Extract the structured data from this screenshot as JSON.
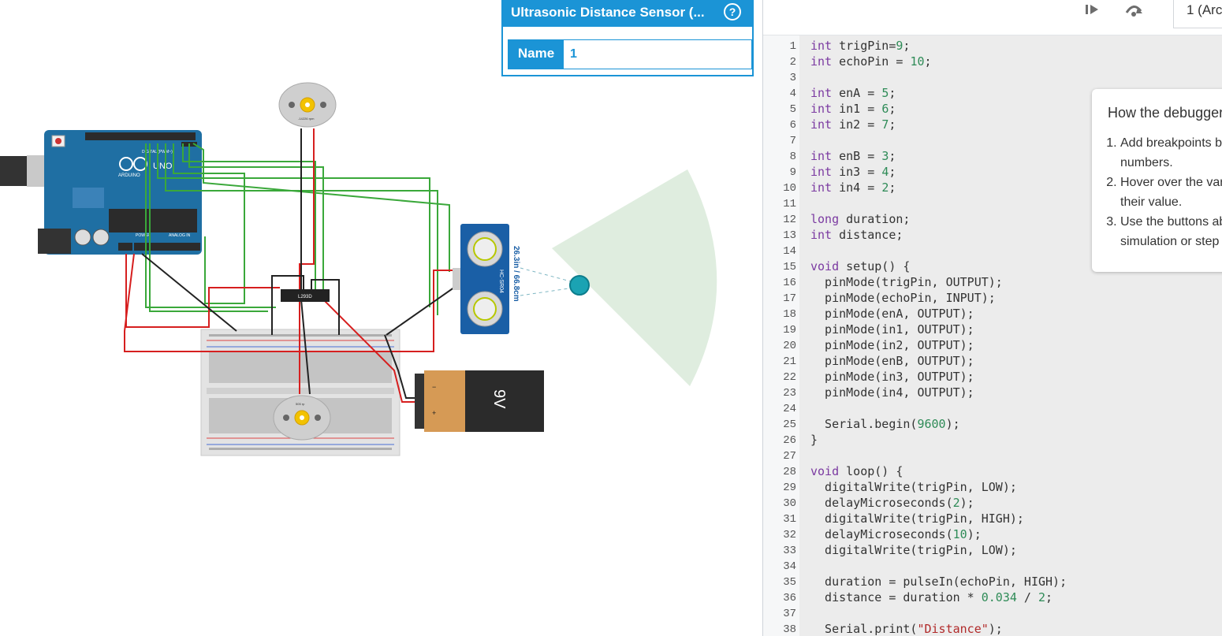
{
  "inspector": {
    "title": "Ultrasonic Distance Sensor (...",
    "help_icon": "?",
    "name_label": "Name",
    "name_value": "1"
  },
  "circuit": {
    "arduino_board_label": "UNO",
    "arduino_brand": "ARDUINO",
    "arduino_digital_label": "DIGITAL (PWM~)",
    "arduino_power_label": "POWER",
    "arduino_analog_label": "ANALOG IN",
    "driver_chip_label": "L293D",
    "sensor_label": "HC-SR04",
    "sensor_reading": "26.3in / 66.8cm",
    "battery_label": "9V",
    "motor_top_label": "-14226 rpm",
    "motor_bottom_label": "505 rp",
    "battery_minus": "−",
    "battery_plus": "+"
  },
  "toolbar": {
    "file_tab": "1 (Arc"
  },
  "code": {
    "lines": [
      "int trigPin=9;",
      "int echoPin = 10;",
      "",
      "int enA = 5;",
      "int in1 = 6;",
      "int in2 = 7;",
      "",
      "int enB = 3;",
      "int in3 = 4;",
      "int in4 = 2;",
      "",
      "long duration;",
      "int distance;",
      "",
      "void setup() {",
      "  pinMode(trigPin, OUTPUT);",
      "  pinMode(echoPin, INPUT);",
      "  pinMode(enA, OUTPUT);",
      "  pinMode(in1, OUTPUT);",
      "  pinMode(in2, OUTPUT);",
      "  pinMode(enB, OUTPUT);",
      "  pinMode(in3, OUTPUT);",
      "  pinMode(in4, OUTPUT);",
      "",
      "  Serial.begin(9600);",
      "}",
      "",
      "void loop() {",
      "  digitalWrite(trigPin, LOW);",
      "  delayMicroseconds(2);",
      "  digitalWrite(trigPin, HIGH);",
      "  delayMicroseconds(10);",
      "  digitalWrite(trigPin, LOW);",
      "",
      "  duration = pulseIn(echoPin, HIGH);",
      "  distance = duration * 0.034 / 2;",
      "",
      "  Serial.print(\"Distance\");"
    ]
  },
  "debugger_tip": {
    "title": "How the debugger w",
    "steps": [
      "Add breakpoints by cl line numbers.",
      "Hover over the variab to see their value.",
      "Use the buttons abov simulation or step on"
    ]
  },
  "colors": {
    "accent": "#1b94d6",
    "wire_green": "#3aa83a",
    "wire_red": "#d61f1f",
    "arduino_blue": "#1f6fa3",
    "sensor_blue": "#1a5fa6"
  }
}
